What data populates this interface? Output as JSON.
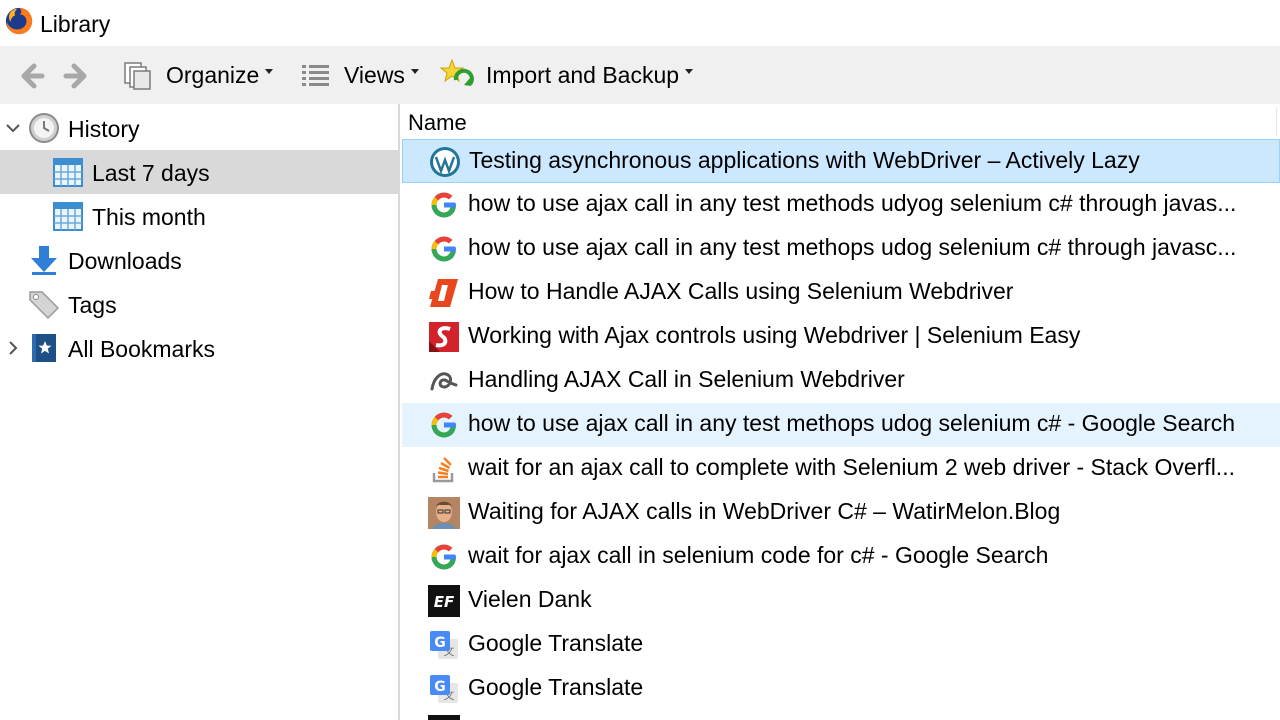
{
  "window": {
    "title": "Library"
  },
  "toolbar": {
    "organize": "Organize",
    "views": "Views",
    "import_backup": "Import and Backup"
  },
  "sidebar": {
    "items": [
      {
        "label": "History",
        "icon": "clock-icon",
        "expanded": true
      },
      {
        "label": "Last 7 days",
        "icon": "calendar-icon",
        "selected": true
      },
      {
        "label": "This month",
        "icon": "calendar-icon"
      },
      {
        "label": "Downloads",
        "icon": "download-icon"
      },
      {
        "label": "Tags",
        "icon": "tag-icon"
      },
      {
        "label": "All Bookmarks",
        "icon": "bookmarks-icon",
        "expanded": false
      }
    ]
  },
  "list": {
    "column_name": "Name",
    "rows": [
      {
        "title": "Testing asynchronous applications with WebDriver – Actively Lazy",
        "icon": "wordpress-icon"
      },
      {
        "title": "how to use ajax call in any test methods udyog selenium c# through javas...",
        "icon": "google-icon"
      },
      {
        "title": "how to use ajax call in any test methops udog selenium c# through javasc...",
        "icon": "google-icon"
      },
      {
        "title": "How to Handle AJAX Calls using Selenium Webdriver",
        "icon": "guru99-icon"
      },
      {
        "title": "Working with Ajax controls using Webdriver | Selenium Easy",
        "icon": "selenium-easy-icon"
      },
      {
        "title": "Handling AJAX Call in Selenium Webdriver",
        "icon": "swirl-icon"
      },
      {
        "title": "how to use ajax call in any test methops udog selenium c# - Google Search",
        "icon": "google-icon"
      },
      {
        "title": "wait for an ajax call to complete with Selenium 2 web driver - Stack Overfl...",
        "icon": "stackoverflow-icon"
      },
      {
        "title": "Waiting for AJAX calls in WebDriver C# – WatirMelon.Blog",
        "icon": "avatar-icon"
      },
      {
        "title": "wait for ajax call in selenium code for c# - Google Search",
        "icon": "google-icon"
      },
      {
        "title": "Vielen Dank",
        "icon": "ef-icon"
      },
      {
        "title": "Google Translate",
        "icon": "google-translate-icon"
      },
      {
        "title": "Google Translate",
        "icon": "google-translate-icon"
      }
    ]
  }
}
